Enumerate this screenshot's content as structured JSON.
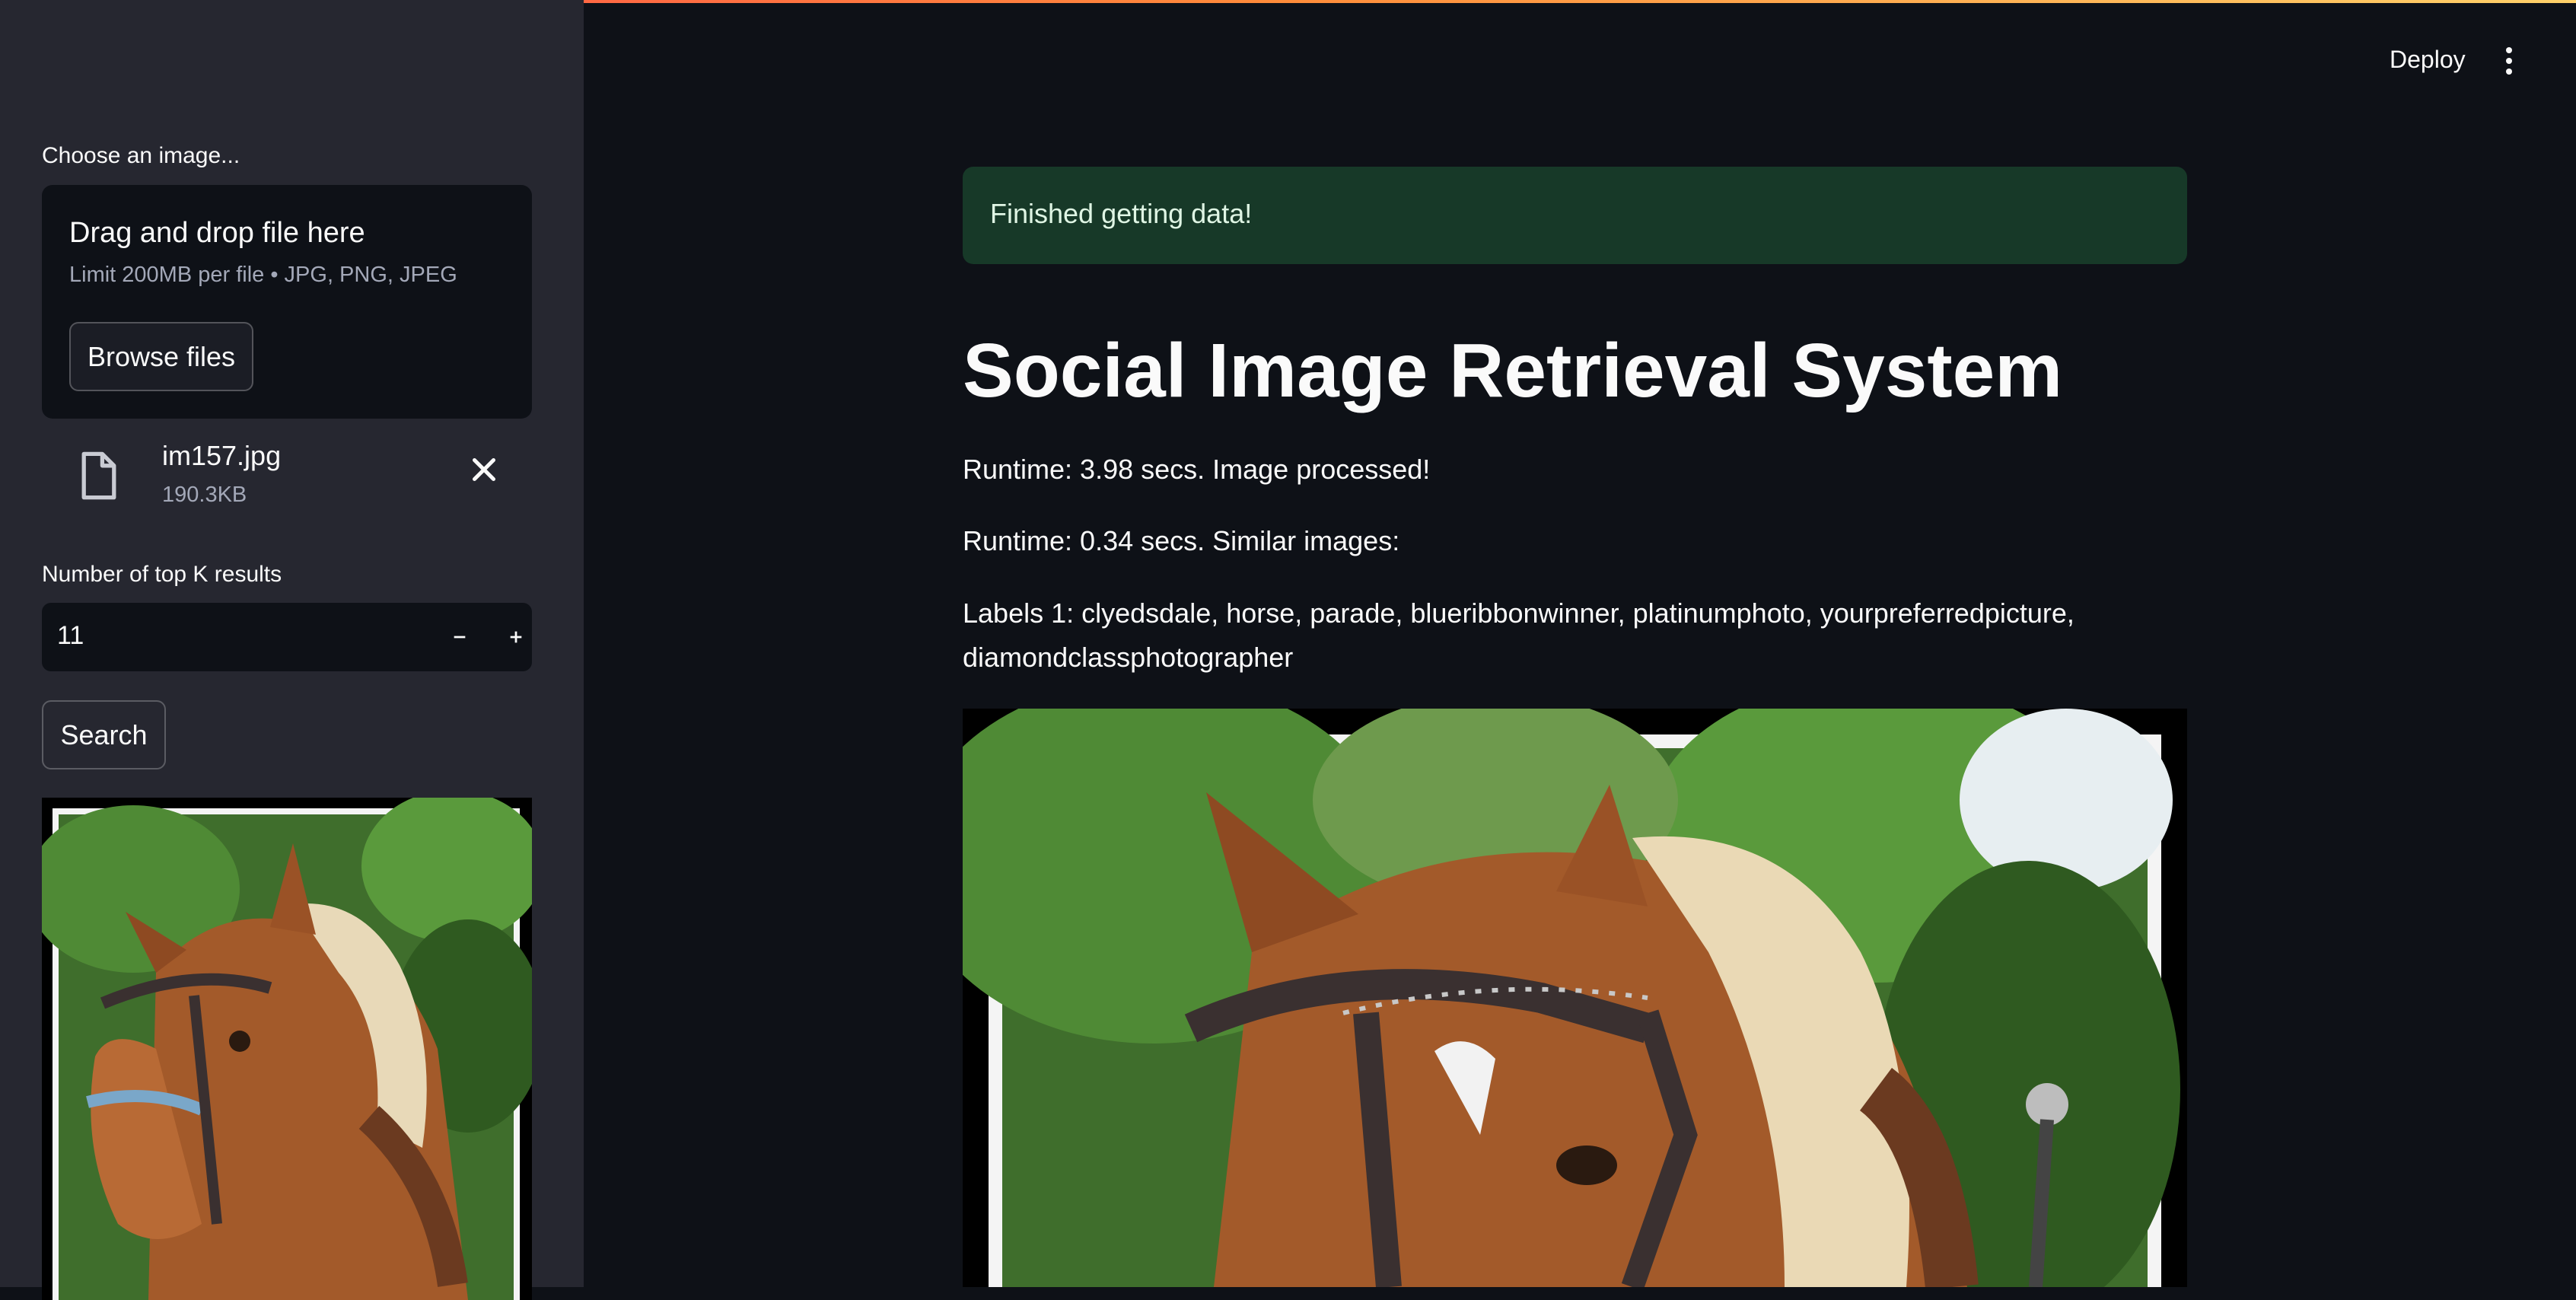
{
  "sidebar": {
    "uploader_label": "Choose an image...",
    "dropzone_title": "Drag and drop file here",
    "dropzone_limit": "Limit 200MB per file • JPG, PNG, JPEG",
    "browse_label": "Browse files",
    "file": {
      "name": "im157.jpg",
      "size": "190.3KB"
    },
    "topk_label": "Number of top K results",
    "topk_value": "11",
    "search_label": "Search"
  },
  "header": {
    "deploy_label": "Deploy"
  },
  "main": {
    "alert": "Finished getting data!",
    "title": "Social Image Retrieval System",
    "runtime_processed": "Runtime: 3.98 secs. Image processed!",
    "runtime_similar": "Runtime: 0.34 secs. Similar images:",
    "labels": "Labels 1: clyedsdale, horse, parade, blueribbonwinner, platinumphoto, yourpreferredpicture, diamondclassphotographer"
  },
  "colors": {
    "background": "#0e1117",
    "sidebar": "#262730",
    "success_bg": "#173928",
    "accent_gradient_start": "#ff4b4b",
    "accent_gradient_end": "#ffd16a"
  },
  "icons": [
    "file-icon",
    "close-icon",
    "minus-icon",
    "plus-icon",
    "kebab-menu-icon"
  ]
}
